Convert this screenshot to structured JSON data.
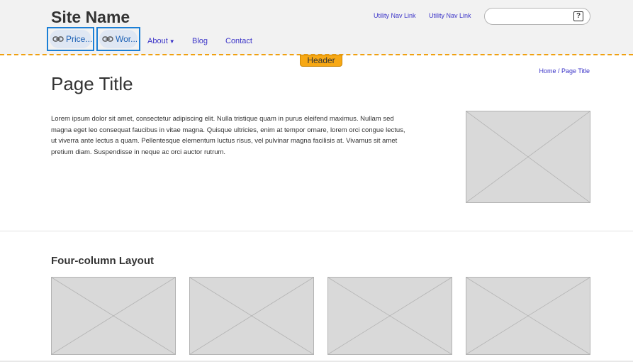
{
  "header": {
    "site_name": "Site Name",
    "utility_links": [
      "Utility Nav Link",
      "Utility Nav Link"
    ],
    "search": {
      "placeholder": "",
      "icon": "help-icon",
      "icon_glyph": "?"
    },
    "link_chips": [
      {
        "label": "Price...",
        "icon": "link-icon"
      },
      {
        "label": "Wor...",
        "icon": "link-icon"
      }
    ],
    "nav": {
      "about": "About",
      "blog": "Blog",
      "contact": "Contact"
    },
    "tag": "Header"
  },
  "breadcrumb": "Home / Page Title",
  "page_title": "Page Title",
  "body_text": "Lorem ipsum dolor sit amet, consectetur adipiscing elit. Nulla tristique quam in purus eleifend maximus. Nullam sed magna eget leo consequat faucibus in vitae magna. Quisque ultricies, enim at tempor ornare, lorem orci congue lectus, ut viverra ante lectus a quam. Pellentesque elementum luctus risus, vel pulvinar magna facilisis at. Vivamus sit amet pretium diam. Suspendisse in neque ac orci auctor rutrum.",
  "section_title": "Four-column Layout",
  "colors": {
    "link": "#3c35c8",
    "chip_border": "#1b7fd6",
    "header_tag": "#f7a814",
    "placeholder": "#d9d9d9"
  }
}
